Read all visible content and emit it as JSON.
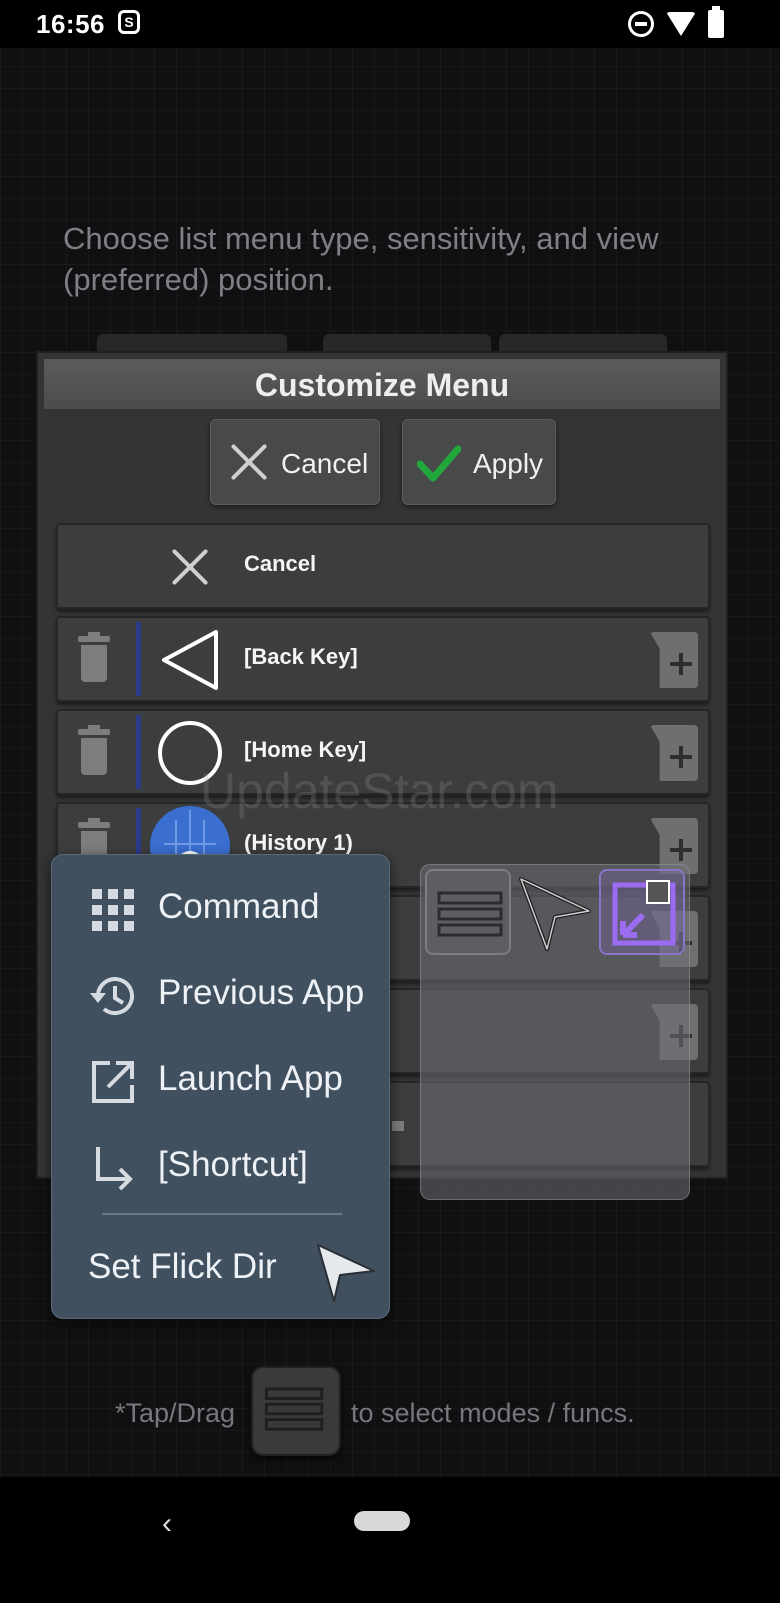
{
  "status_bar": {
    "time": "16:56"
  },
  "instruction_text": "Choose list menu type, sensitivity, and view (preferred) position.",
  "dialog": {
    "title": "Customize Menu",
    "cancel_button": "Cancel",
    "apply_button": "Apply",
    "rows": [
      {
        "label": "Cancel",
        "icon": "close-icon"
      },
      {
        "label": "[Back Key]",
        "icon": "back-triangle-icon"
      },
      {
        "label": "[Home Key]",
        "icon": "home-circle-icon"
      },
      {
        "label": "(History 1)",
        "icon": "android-app-icon"
      }
    ]
  },
  "popup_menu": {
    "items": [
      {
        "label": "Command",
        "icon": "grid-icon"
      },
      {
        "label": "Previous App",
        "icon": "history-icon"
      },
      {
        "label": "Launch App",
        "icon": "launch-icon"
      },
      {
        "label": "[Shortcut]",
        "icon": "shortcut-arrow-icon"
      }
    ],
    "flick_label": "Set Flick Dir"
  },
  "watermark": "UpdateStar.com",
  "hint": {
    "before": "*Tap/Drag",
    "after": "to select modes / funcs."
  },
  "colors": {
    "accent_check": "#22a83a",
    "popup_bg": "#41505f",
    "highlight_purple": "#9b6cf0"
  }
}
